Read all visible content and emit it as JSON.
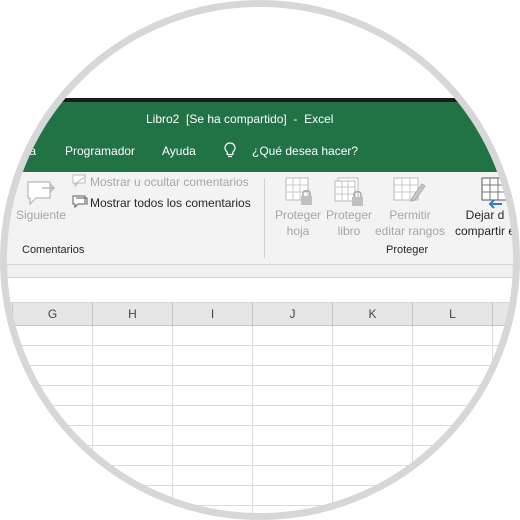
{
  "window": {
    "title": "Libro2  [Se ha compartido]  -  Excel"
  },
  "menu": {
    "tabs": [
      {
        "label": "ta"
      },
      {
        "label": "Programador"
      },
      {
        "label": "Ayuda"
      }
    ],
    "tell_me": "¿Qué desea hacer?"
  },
  "ribbon": {
    "comments": {
      "next_label": "Siguiente",
      "show_hide_label": "Mostrar u ocultar comentarios",
      "show_all_label": "Mostrar todos los comentarios",
      "group_label": "Comentarios"
    },
    "protect": {
      "protect_sheet_line1": "Proteger",
      "protect_sheet_line2": "hoja",
      "protect_book_line1": "Proteger",
      "protect_book_line2": "libro",
      "allow_ranges_line1": "Permitir",
      "allow_ranges_line2": "editar rangos",
      "stop_sharing_line1": "Dejar d",
      "stop_sharing_line2": "compartir e",
      "group_label": "Proteger"
    }
  },
  "sheet": {
    "columns": [
      "G",
      "H",
      "I",
      "J",
      "K",
      "L"
    ]
  },
  "annotation": {
    "arrow_color": "#f26b6b"
  },
  "colors": {
    "excel_green": "#217346",
    "ribbon_bg": "#f3f3f3",
    "header_bg": "#e6e6e6"
  }
}
